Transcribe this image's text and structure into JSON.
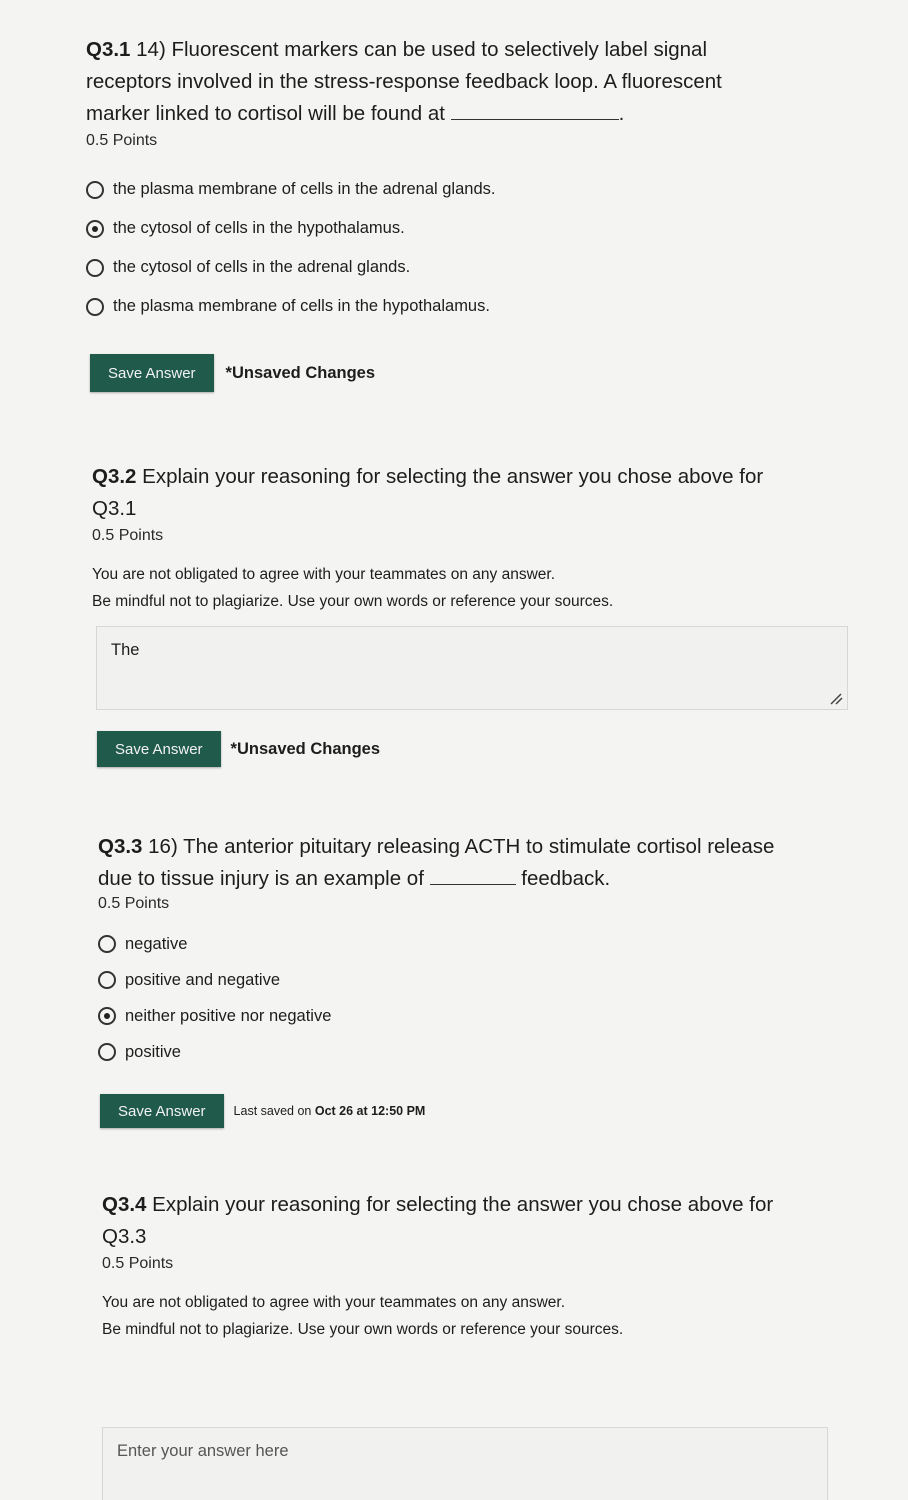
{
  "q31": {
    "number": "Q3.1",
    "text_line1": " 14) Fluorescent markers can be used to selectively label signal",
    "text_line2": "receptors involved in the stress-response feedback loop. A fluorescent",
    "text_line3": "marker linked to cortisol will be found at",
    "trailing": ".",
    "points": "0.5 Points",
    "options": [
      {
        "label": "the plasma membrane of cells in the adrenal glands.",
        "checked": false
      },
      {
        "label": "the cytosol of cells in the hypothalamus.",
        "checked": true
      },
      {
        "label": "the cytosol of cells in the adrenal glands.",
        "checked": false
      },
      {
        "label": "the plasma membrane of cells in the hypothalamus.",
        "checked": false
      }
    ],
    "save_label": "Save Answer",
    "status": "*Unsaved Changes"
  },
  "q32": {
    "number": "Q3.2",
    "text_line1": " Explain your reasoning for selecting the answer you chose above for",
    "text_line2": "Q3.1",
    "points": "0.5 Points",
    "note_line1": "You are not obligated to agree with your teammates on any answer.",
    "note_line2": "Be mindful not to plagiarize. Use your own words or reference your sources.",
    "answer_value": "The",
    "save_label": "Save Answer",
    "status": "*Unsaved Changes"
  },
  "q33": {
    "number": "Q3.3",
    "text_line1": " 16) The anterior pituitary releasing ACTH to stimulate cortisol release",
    "text_line2a": "due to tissue injury is an example of",
    "text_line2b": " feedback.",
    "points": "0.5 Points",
    "options": [
      {
        "label": "negative",
        "checked": false
      },
      {
        "label": "positive and negative",
        "checked": false
      },
      {
        "label": "neither positive nor negative",
        "checked": true
      },
      {
        "label": "positive",
        "checked": false
      }
    ],
    "save_label": "Save Answer",
    "status_prefix": "Last saved on",
    "status_date": "Oct 26 at 12:50 PM"
  },
  "q34": {
    "number": "Q3.4",
    "text_line1": " Explain your reasoning for selecting the answer you chose above for",
    "text_line2": "Q3.3",
    "points": "0.5 Points",
    "note_line1": "You are not obligated to agree with your teammates on any answer.",
    "note_line2": "Be mindful not to plagiarize. Use your own words or reference your sources.",
    "answer_placeholder": "Enter your answer here"
  }
}
